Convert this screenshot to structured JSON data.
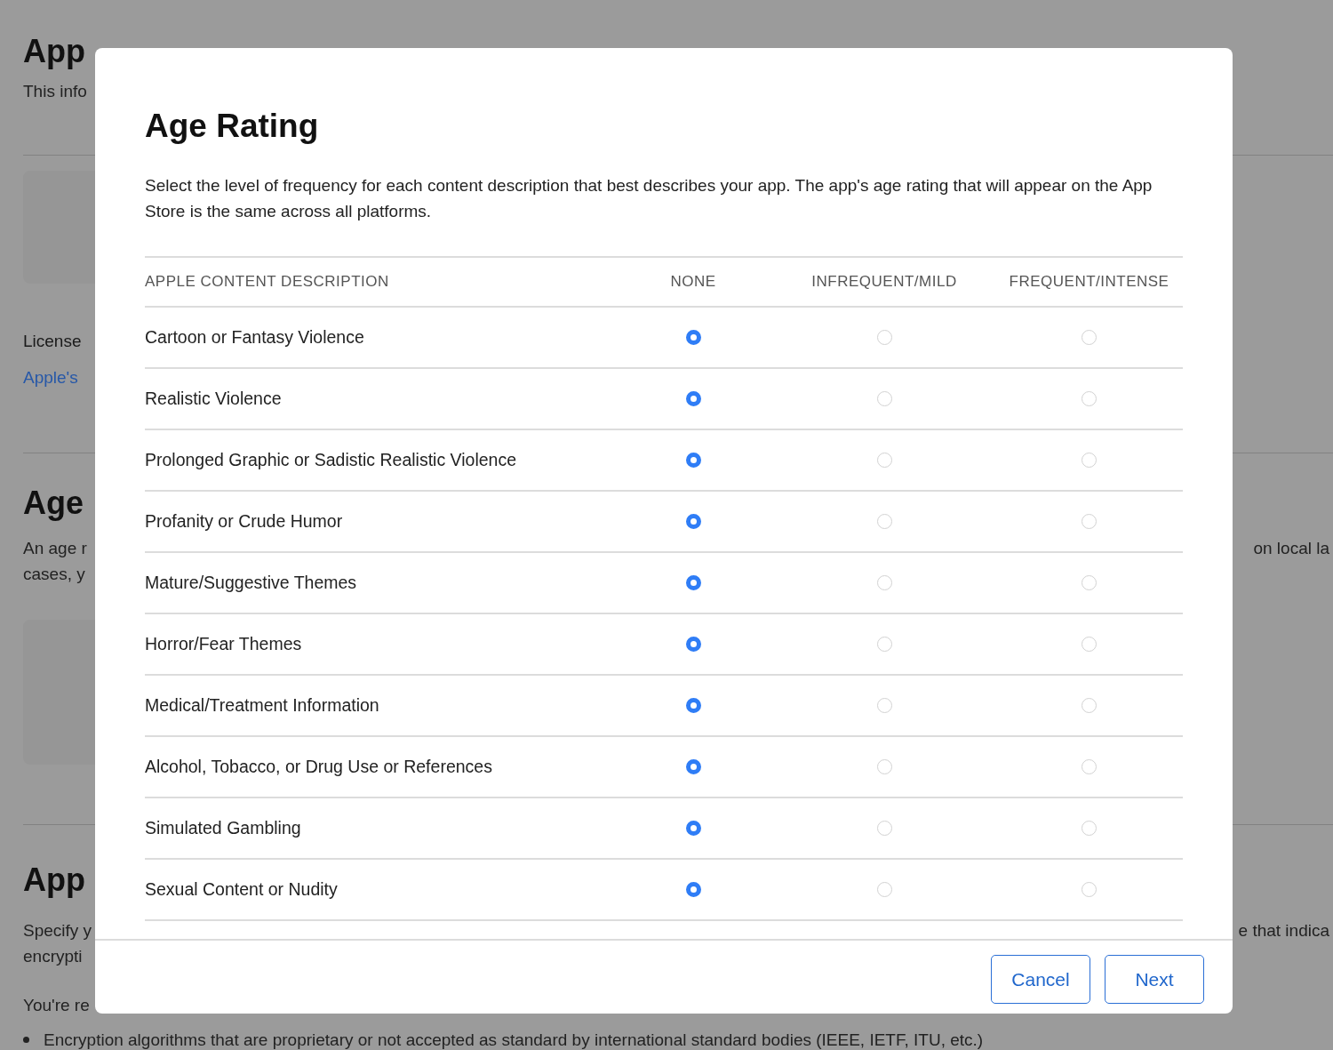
{
  "background": {
    "heading_1": "App",
    "intro": "This info",
    "license_label": "License",
    "license_link": "Apple's",
    "heading_2": "Age",
    "age_lines": [
      "An age r",
      "cases, y"
    ],
    "age_right": "on local la",
    "heading_3": "App",
    "encryption_lines": [
      "Specify y",
      "encrypti"
    ],
    "encryption_right": "e that indica",
    "responsibility": "You're re",
    "bullet": "Encryption algorithms that are proprietary or not accepted as standard by international standard bodies (IEEE, IETF, ITU, etc.)"
  },
  "dialog": {
    "title": "Age Rating",
    "description": "Select the level of frequency for each content description that best describes your app. The app's age rating that will appear on the App Store is the same across all platforms.",
    "columns": [
      "APPLE CONTENT DESCRIPTION",
      "NONE",
      "INFREQUENT/MILD",
      "FREQUENT/INTENSE"
    ],
    "rows": [
      {
        "label": "Cartoon or Fantasy Violence",
        "choices": [
          {
            "selected": true
          },
          {
            "selected": false
          },
          {
            "selected": false
          }
        ]
      },
      {
        "label": "Realistic Violence",
        "choices": [
          {
            "selected": true
          },
          {
            "selected": false
          },
          {
            "selected": false
          }
        ]
      },
      {
        "label": "Prolonged Graphic or Sadistic Realistic Violence",
        "choices": [
          {
            "selected": true
          },
          {
            "selected": false
          },
          {
            "selected": false
          }
        ]
      },
      {
        "label": "Profanity or Crude Humor",
        "choices": [
          {
            "selected": true
          },
          {
            "selected": false
          },
          {
            "selected": false
          }
        ]
      },
      {
        "label": "Mature/Suggestive Themes",
        "choices": [
          {
            "selected": true
          },
          {
            "selected": false
          },
          {
            "selected": false
          }
        ]
      },
      {
        "label": "Horror/Fear Themes",
        "choices": [
          {
            "selected": true
          },
          {
            "selected": false
          },
          {
            "selected": false
          }
        ]
      },
      {
        "label": "Medical/Treatment Information",
        "choices": [
          {
            "selected": true
          },
          {
            "selected": false
          },
          {
            "selected": false
          }
        ]
      },
      {
        "label": "Alcohol, Tobacco, or Drug Use or References",
        "choices": [
          {
            "selected": true
          },
          {
            "selected": false
          },
          {
            "selected": false
          }
        ]
      },
      {
        "label": "Simulated Gambling",
        "choices": [
          {
            "selected": true
          },
          {
            "selected": false
          },
          {
            "selected": false
          }
        ]
      },
      {
        "label": "Sexual Content or Nudity",
        "choices": [
          {
            "selected": true
          },
          {
            "selected": false
          },
          {
            "selected": false
          }
        ]
      }
    ],
    "buttons": [
      "Cancel",
      "Next"
    ]
  }
}
